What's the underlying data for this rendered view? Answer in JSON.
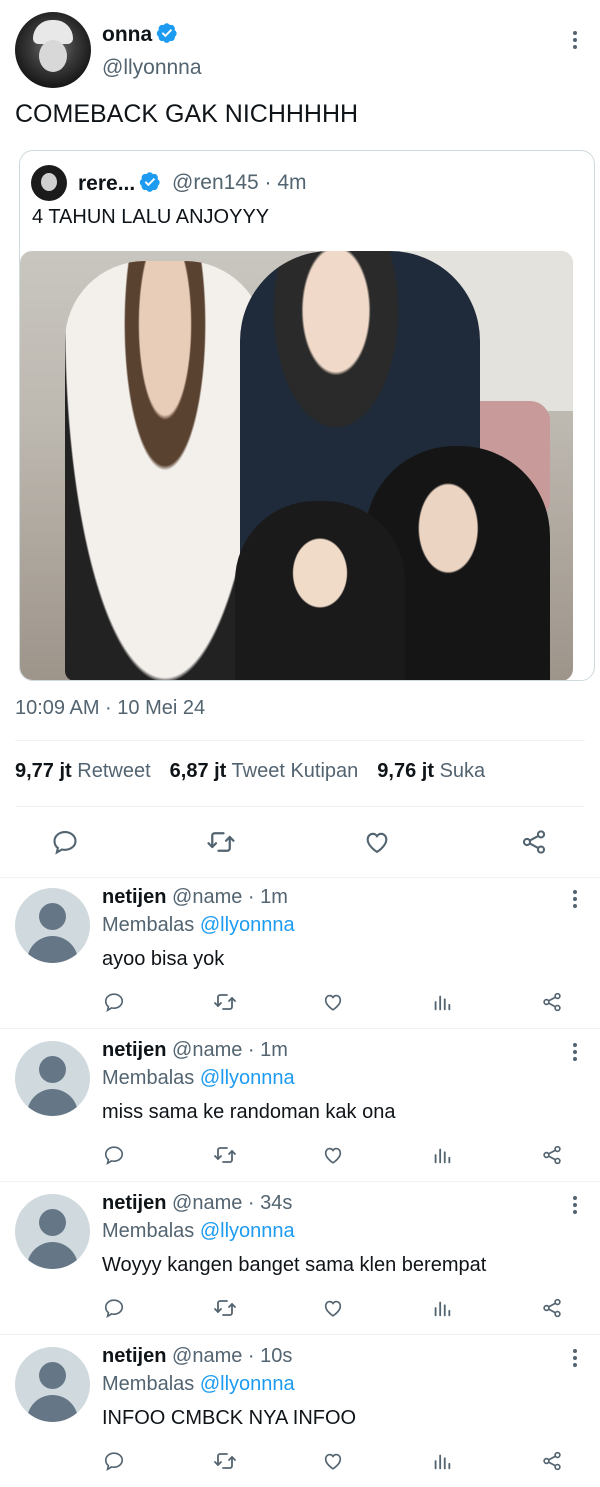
{
  "tweet": {
    "author_name": "onna",
    "author_handle": "@llyonnna",
    "text": "COMEBACK GAK NICHHHHH",
    "timestamp": "10:09 AM · 10 Mei 24"
  },
  "quote": {
    "name": "rere...",
    "handle_time": "@ren145 · 4m",
    "text": "4 TAHUN LALU ANJOYYY"
  },
  "stats": {
    "retweets_value": "9,77 jt",
    "retweets_label": "Retweet",
    "quotes_value": "6,87 jt",
    "quotes_label": "Tweet Kutipan",
    "likes_value": "9,76 jt",
    "likes_label": "Suka"
  },
  "actions": [
    "reply-icon",
    "retweet-icon",
    "like-icon",
    "share-icon"
  ],
  "replies": [
    {
      "name": "netijen",
      "handle_time": "@name · 1m",
      "replying_prefix": "Membalas",
      "replying_to": "@llyonnna",
      "text": "ayoo bisa yok"
    },
    {
      "name": "netijen",
      "handle_time": "@name · 1m",
      "replying_prefix": "Membalas",
      "replying_to": "@llyonnna",
      "text": "miss sama ke randoman kak ona"
    },
    {
      "name": "netijen",
      "handle_time": "@name · 34s",
      "replying_prefix": "Membalas",
      "replying_to": "@llyonnna",
      "text": "Woyyy kangen banget sama klen berempat"
    },
    {
      "name": "netijen",
      "handle_time": "@name · 10s",
      "replying_prefix": "Membalas",
      "replying_to": "@llyonnna",
      "text": "INFOO CMBCK NYA INFOO"
    }
  ],
  "colors": {
    "verified": "#1d9bf0",
    "secondary": "#536471",
    "primary": "#0f1419"
  }
}
